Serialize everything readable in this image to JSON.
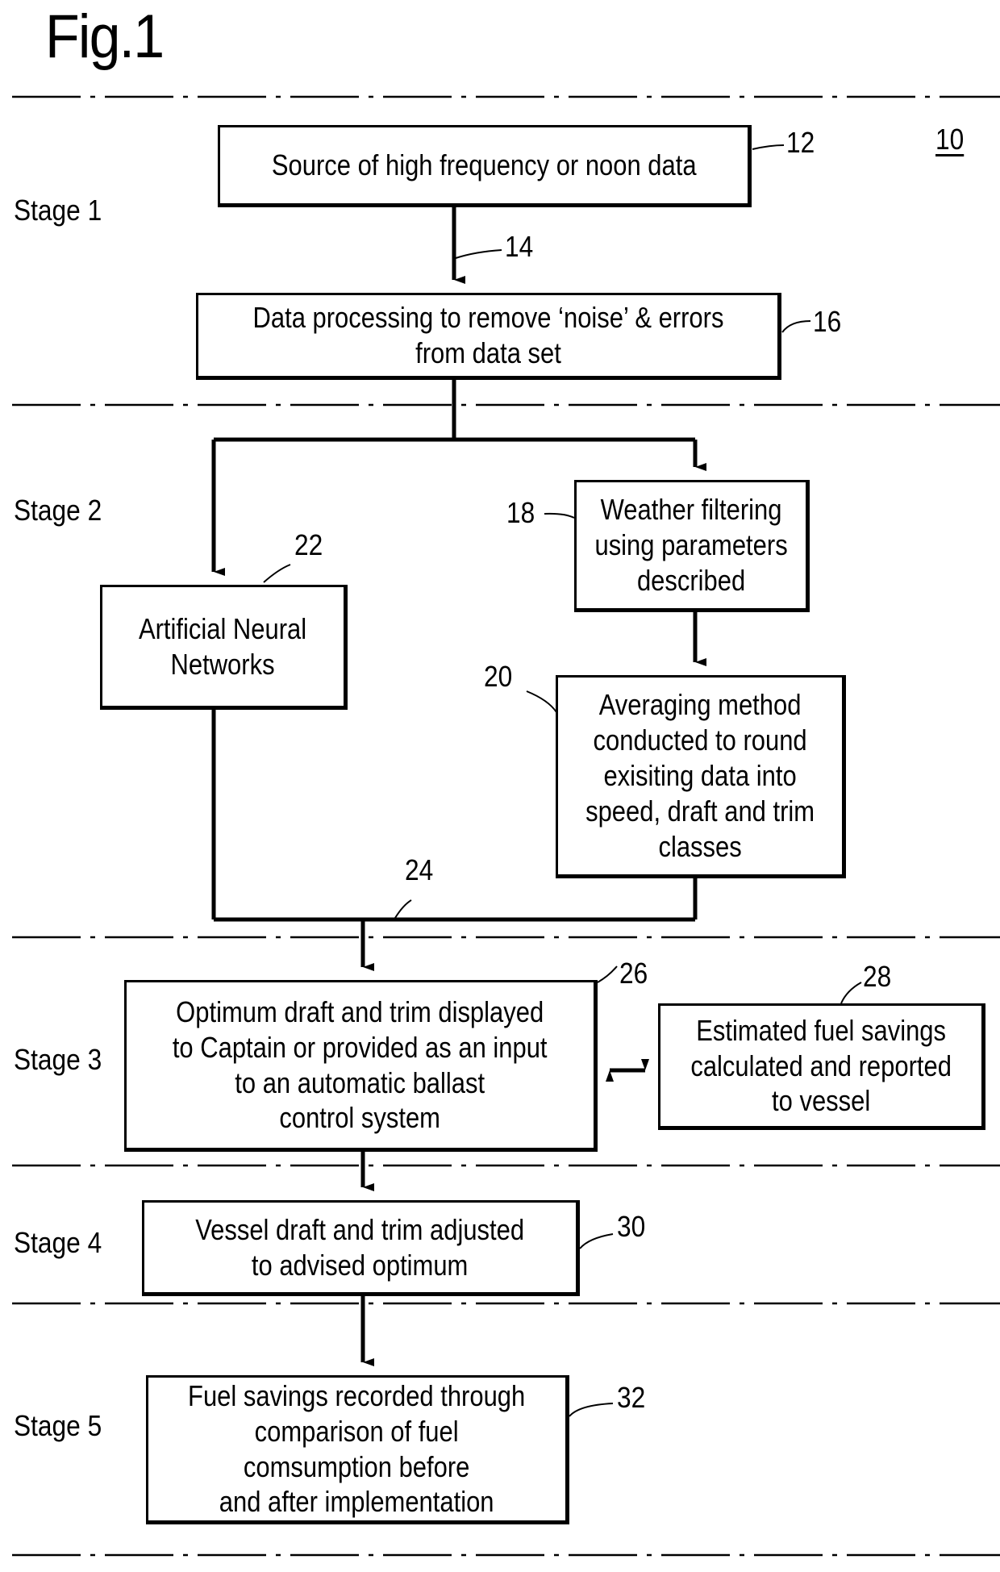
{
  "figure": {
    "title": "Fig.1",
    "reference": "10"
  },
  "stages": [
    {
      "label": "Stage 1"
    },
    {
      "label": "Stage 2"
    },
    {
      "label": "Stage 3"
    },
    {
      "label": "Stage 4"
    },
    {
      "label": "Stage 5"
    }
  ],
  "nodes": {
    "source": {
      "ref": "12",
      "text": "Source of high frequency or noon data"
    },
    "processing": {
      "ref": "16",
      "text": "Data processing to remove ‘noise’ & errors\nfrom data set"
    },
    "weather": {
      "ref": "18",
      "text": "Weather filtering\nusing parameters\ndescribed"
    },
    "averaging": {
      "ref": "20",
      "text": "Averaging method\nconducted to round\nexisiting data into\nspeed, draft and trim\nclasses"
    },
    "ann": {
      "ref": "22",
      "text": "Artificial Neural\nNetworks"
    },
    "optimum": {
      "ref": "26",
      "text": "Optimum draft and trim displayed\nto Captain or provided as an input\nto an automatic ballast\ncontrol system"
    },
    "estimated": {
      "ref": "28",
      "text": "Estimated fuel savings\ncalculated and reported\nto vessel"
    },
    "adjusted": {
      "ref": "30",
      "text": "Vessel draft and trim adjusted\nto advised optimum"
    },
    "recorded": {
      "ref": "32",
      "text": "Fuel savings recorded through\ncomparison of fuel\ncomsumption before\nand after implementation"
    }
  },
  "connectors": {
    "arrow_source_to_processing": {
      "ref": "14"
    },
    "merge_line": {
      "ref": "24"
    }
  }
}
